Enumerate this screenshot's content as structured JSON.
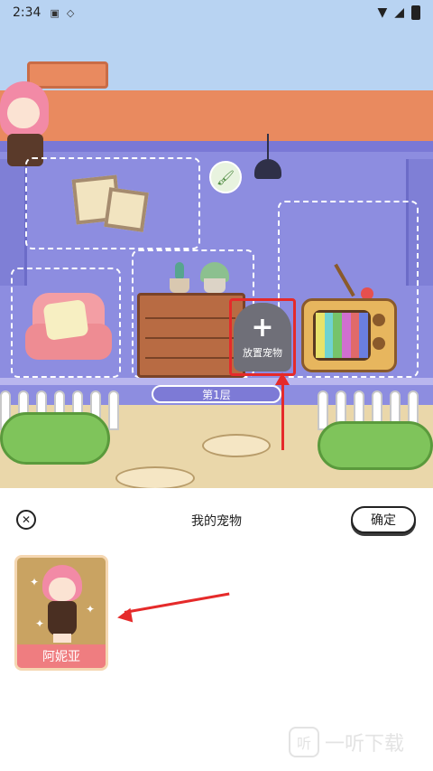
{
  "status_bar": {
    "time": "2:34",
    "icons": [
      "notification-a-icon",
      "diamond-icon",
      "wifi-icon",
      "signal-icon",
      "battery-icon"
    ]
  },
  "scene": {
    "floor_label": "第1层",
    "place_pet_label": "放置宠物",
    "place_pet_plus": "+",
    "brush_icon": "paint-brush-icon",
    "colors": {
      "sky": "#b8d3f2",
      "wall": "#8d8de0",
      "roof": "#e98a5f",
      "ground": "#ead7aa",
      "highlight_red": "#e52a2a"
    }
  },
  "sheet": {
    "title": "我的宠物",
    "close_icon": "close-icon",
    "confirm_label": "确定",
    "pets": [
      {
        "name": "阿妮亚"
      }
    ]
  },
  "watermark": {
    "logo_text": "听",
    "text": "一听下载"
  }
}
